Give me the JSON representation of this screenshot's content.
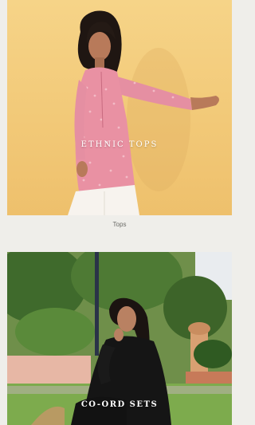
{
  "categories": [
    {
      "overlay_title": "ETHNIC TOPS",
      "caption": "Tops"
    },
    {
      "overlay_title": "CO-ORD SETS"
    }
  ],
  "colors": {
    "page_background": "#efeeea",
    "tops_backdrop": "#f2c978",
    "tunic_pink": "#e991a3",
    "coord_black": "#151515",
    "foliage_green": "#4e7a34"
  }
}
